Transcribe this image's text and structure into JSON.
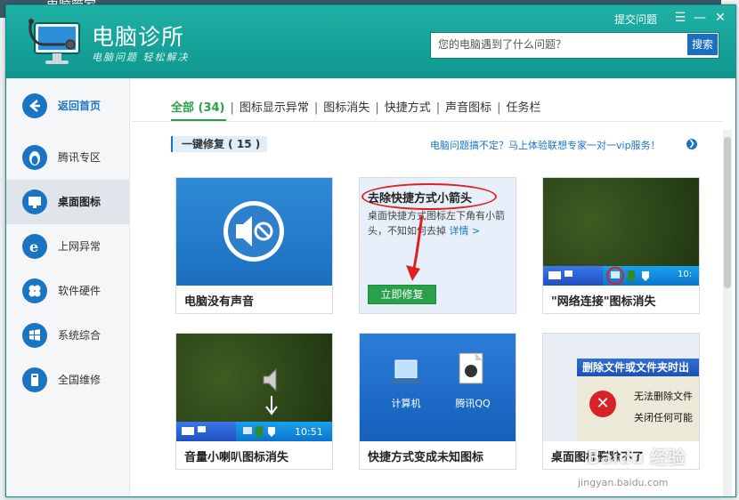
{
  "background_app": {
    "title": "电脑管家"
  },
  "window": {
    "app_title": "电脑诊所",
    "app_slogan": "电脑问题 轻松解决",
    "feedback_label": "提交问题",
    "menu_icon": "menu-icon",
    "minimize_icon": "minimize-icon",
    "close_icon": "close-icon"
  },
  "search": {
    "placeholder": "您的电脑遇到了什么问题？",
    "button_label": "搜索"
  },
  "sidebar": {
    "items": [
      {
        "label": "返回首页",
        "icon": "back-arrow-icon"
      },
      {
        "label": "腾讯专区",
        "icon": "qq-penguin-icon"
      },
      {
        "label": "桌面图标",
        "icon": "monitor-icon"
      },
      {
        "label": "上网异常",
        "icon": "ie-browser-icon"
      },
      {
        "label": "软件硬件",
        "icon": "windows-logo-icon"
      },
      {
        "label": "系统综合",
        "icon": "windows-flag-icon"
      },
      {
        "label": "全国维修",
        "icon": "pc-tower-icon"
      }
    ]
  },
  "tabs": [
    {
      "label": "全部 (34)"
    },
    {
      "label": "图标显示异常"
    },
    {
      "label": "图标消失"
    },
    {
      "label": "快捷方式"
    },
    {
      "label": "声音图标"
    },
    {
      "label": "任务栏"
    }
  ],
  "section": {
    "label": "一键修复 ( 15 )"
  },
  "promo": {
    "text": "电脑问题搞不定？马上体验联想专家一对一vip服务！"
  },
  "cards": [
    {
      "caption": "电脑没有声音"
    },
    {
      "title": "去除快捷方式小箭头",
      "desc": "桌面快捷方式图标左下角有小箭头，不知如何去掉",
      "link": "详情 >",
      "button": "立即修复"
    },
    {
      "caption": "\"网络连接\"图标消失",
      "clock": "10:"
    },
    {
      "caption": "音量小喇叭图标消失",
      "clock": "10:51"
    },
    {
      "caption": "快捷方式变成未知图标",
      "icon1_label": "计算机",
      "icon2_label": "腾讯QQ"
    },
    {
      "caption": "桌面图标删除不了",
      "dialog_title": "删除文件或文件夹时出",
      "dialog_line1": "无法删除文件",
      "dialog_line2": "关闭任何可能"
    }
  ],
  "watermark": {
    "text": "Baidu 经验",
    "sub": "jingyan.baidu.com"
  },
  "colors": {
    "header": "#17a89d",
    "accent_green": "#2aa04a",
    "link_blue": "#1a74c4",
    "alert_red": "#e02020"
  }
}
